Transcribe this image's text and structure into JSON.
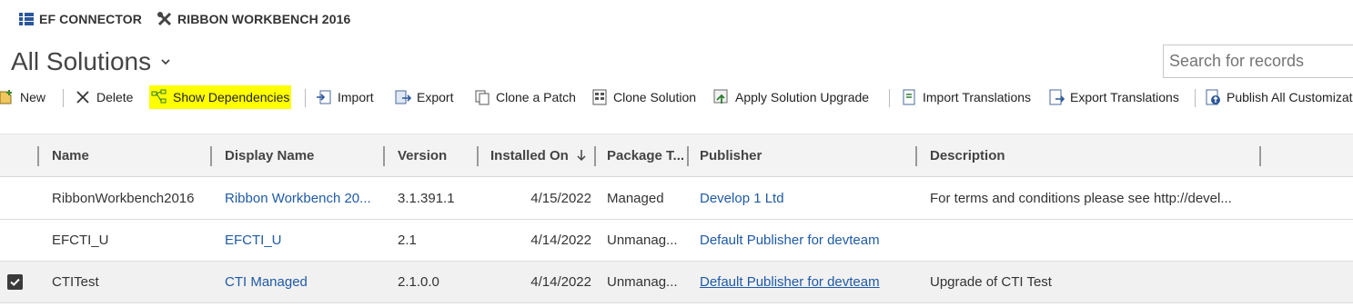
{
  "topbar": {
    "ef_connector": "EF CONNECTOR",
    "ribbon_workbench": "RIBBON WORKBENCH 2016"
  },
  "view": {
    "title": "All Solutions"
  },
  "search": {
    "placeholder": "Search for records"
  },
  "commands": {
    "new": "New",
    "delete": "Delete",
    "show_dependencies": "Show Dependencies",
    "import": "Import",
    "export": "Export",
    "clone_patch": "Clone a Patch",
    "clone_solution": "Clone Solution",
    "apply_upgrade": "Apply Solution Upgrade",
    "import_translations": "Import Translations",
    "export_translations": "Export Translations",
    "publish_all": "Publish All Customizati"
  },
  "colors": {
    "highlight": "#ffff00",
    "link": "#1f5aa6"
  },
  "grid": {
    "columns": [
      "Name",
      "Display Name",
      "Version",
      "Installed On",
      "Package T...",
      "Publisher",
      "Description"
    ],
    "rows": [
      {
        "name": "RibbonWorkbench2016",
        "display_name": "Ribbon Workbench 20...",
        "version": "3.1.391.1",
        "installed_on": "4/15/2022",
        "package_type": "Managed",
        "publisher": "Develop 1 Ltd",
        "description": "For terms and conditions please see http://devel...",
        "selected": false
      },
      {
        "name": "EFCTI_U",
        "display_name": "EFCTI_U",
        "version": "2.1",
        "installed_on": "4/14/2022",
        "package_type": "Unmanag...",
        "publisher": "Default Publisher for devteam",
        "description": "",
        "selected": false
      },
      {
        "name": "CTITest",
        "display_name": "CTI Managed",
        "version": "2.1.0.0",
        "installed_on": "4/14/2022",
        "package_type": "Unmanag...",
        "publisher": "Default Publisher for devteam",
        "description": "Upgrade of CTI Test",
        "selected": true
      }
    ]
  }
}
